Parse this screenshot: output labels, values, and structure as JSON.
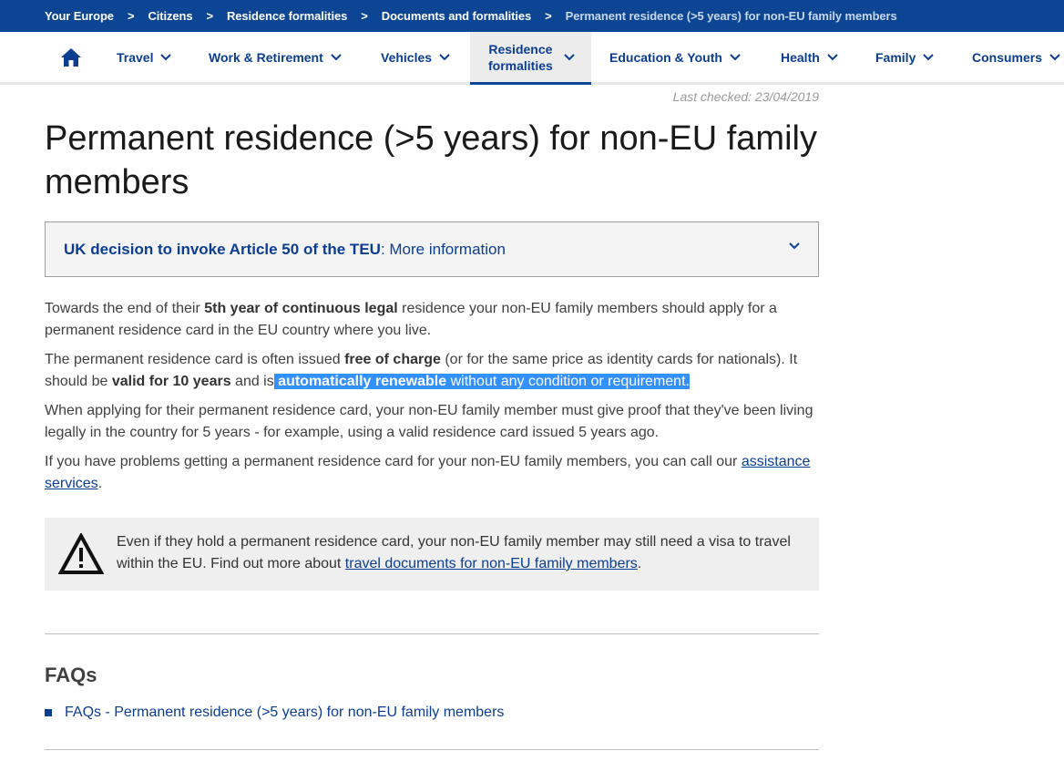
{
  "breadcrumb": {
    "items": [
      "Your Europe",
      "Citizens",
      "Residence formalities",
      "Documents and formalities"
    ],
    "separator": ">",
    "current": "Permanent residence (>5 years) for non-EU family members"
  },
  "nav": {
    "home_icon": "home-icon",
    "items": [
      {
        "label": "Travel"
      },
      {
        "label": "Work & Retirement"
      },
      {
        "label": "Vehicles"
      },
      {
        "label_line1": "Residence",
        "label_line2": "formalities",
        "active": true
      },
      {
        "label": "Education & Youth"
      },
      {
        "label": "Health"
      },
      {
        "label": "Family"
      },
      {
        "label": "Consumers"
      }
    ]
  },
  "last_checked": "Last checked: 23/04/2019",
  "title": "Permanent residence (>5 years) for non-EU family members",
  "uk_box": {
    "bold": "UK decision to invoke Article 50 of the TEU",
    "rest": ": More information"
  },
  "paragraphs": {
    "p1_a": "Towards the end of their ",
    "p1_b": "5th year of continuous legal",
    "p1_c": " residence your non-EU family members should apply for a permanent residence card in the EU country where you live.",
    "p2_a": "The permanent residence card is often issued ",
    "p2_b": "free of charge",
    "p2_c": " (or for the same price as identity cards for nationals). It should be ",
    "p2_d": "valid for 10 years",
    "p2_e": " and is",
    "p2_f": " automatically renewable",
    "p2_g": " without any condition or requirement.",
    "p3": "When applying for their permanent residence card, your non-EU family member must give proof that they've been living legally in the country for 5 years - for example, using a valid residence card issued 5 years ago.",
    "p4_a": "If you have problems getting a permanent residence card for your non-EU family members, you can call our ",
    "p4_link": "assistance services",
    "p4_b": "."
  },
  "warning": {
    "icon": "warning-icon",
    "text_a": "Even if they hold a permanent residence card, your non-EU family member may still need a visa to travel within the EU. Find out more about ",
    "link": "travel documents for non-EU family members",
    "text_b": "."
  },
  "faqs": {
    "title": "FAQs",
    "items": [
      "FAQs - Permanent residence (>5 years) for non-EU family members"
    ]
  },
  "colors": {
    "brand_blue": "#0b4594",
    "link_blue": "#0b3d91",
    "selection": "#3390ff"
  }
}
